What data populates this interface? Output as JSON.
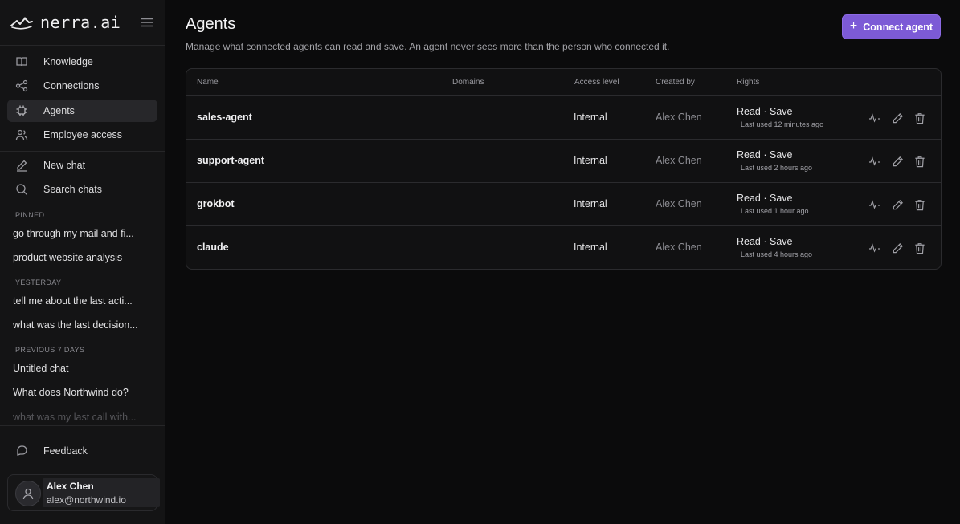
{
  "brand": {
    "name": "nerra.ai"
  },
  "sidebar": {
    "nav": [
      {
        "label": "Knowledge",
        "icon": "book-icon"
      },
      {
        "label": "Connections",
        "icon": "share-nodes-icon"
      },
      {
        "label": "Agents",
        "icon": "chip-icon",
        "active": true
      },
      {
        "label": "Employee access",
        "icon": "users-icon"
      }
    ],
    "actions": [
      {
        "label": "New chat",
        "icon": "pencil-icon"
      },
      {
        "label": "Search chats",
        "icon": "search-icon"
      }
    ],
    "sections": [
      {
        "label": "PINNED",
        "chats": [
          "go through my mail and fi...",
          "product website analysis"
        ]
      },
      {
        "label": "YESTERDAY",
        "chats": [
          "tell me about the last acti...",
          "what was the last decision..."
        ]
      },
      {
        "label": "PREVIOUS 7 DAYS",
        "chats": [
          "Untitled chat",
          "What does Northwind do?",
          "what was my last call with..."
        ]
      }
    ],
    "feedback_label": "Feedback",
    "user": {
      "name": "Alex Chen",
      "email": "alex@northwind.io"
    }
  },
  "main": {
    "title": "Agents",
    "subtitle": "Manage what connected agents can read and save. An agent never sees more than the person who connected it.",
    "connect_label": "Connect agent",
    "table": {
      "headers": {
        "name": "Name",
        "domains": "Domains",
        "access": "Access level",
        "created": "Created by",
        "rights": "Rights"
      },
      "rows": [
        {
          "name": "sales-agent",
          "domains": "",
          "access": "Internal",
          "created_by": "Alex Chen",
          "rights": "Read · Save",
          "last_used": "Last used 12 minutes ago"
        },
        {
          "name": "support-agent",
          "domains": "",
          "access": "Internal",
          "created_by": "Alex Chen",
          "rights": "Read · Save",
          "last_used": "Last used 2 hours ago"
        },
        {
          "name": "grokbot",
          "domains": "",
          "access": "Internal",
          "created_by": "Alex Chen",
          "rights": "Read · Save",
          "last_used": "Last used 1 hour ago"
        },
        {
          "name": "claude",
          "domains": "",
          "access": "Internal",
          "created_by": "Alex Chen",
          "rights": "Read · Save",
          "last_used": "Last used 4 hours ago"
        }
      ]
    }
  },
  "colors": {
    "accent": "#7c5ad6",
    "background": "#0b0b0c",
    "sidebar": "#141415"
  }
}
